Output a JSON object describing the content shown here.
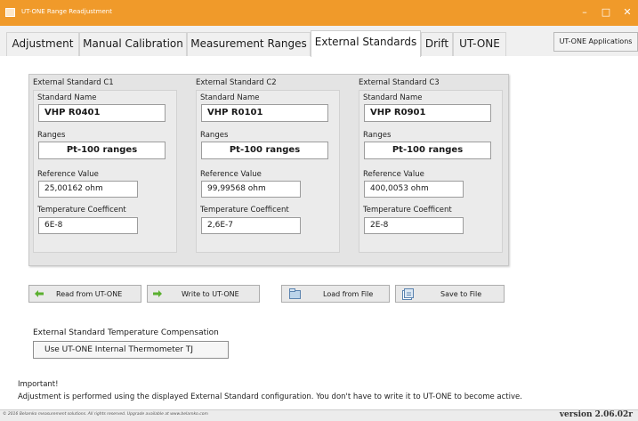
{
  "window": {
    "title": "UT-ONE Range Readjustment",
    "controls": {
      "minimize": "–",
      "maximize": "□",
      "close": "✕"
    }
  },
  "tabs": [
    {
      "label": "Adjustment",
      "active": false
    },
    {
      "label": "Manual Calibration",
      "active": false
    },
    {
      "label": "Measurement Ranges",
      "active": false
    },
    {
      "label": "External Standards",
      "active": true
    },
    {
      "label": "Drift",
      "active": false
    },
    {
      "label": "UT-ONE",
      "active": false
    }
  ],
  "apps_button": "UT-ONE Applications",
  "standards": [
    {
      "title": "External Standard C1",
      "name_label": "Standard Name",
      "name": "VHP R0401",
      "ranges_label": "Ranges",
      "ranges": "Pt-100 ranges",
      "ref_label": "Reference Value",
      "ref": "25,00162 ohm",
      "tc_label": "Temperature Coefficent",
      "tc": "6E-8"
    },
    {
      "title": "External Standard C2",
      "name_label": "Standard Name",
      "name": "VHP R0101",
      "ranges_label": "Ranges",
      "ranges": "Pt-100 ranges",
      "ref_label": "Reference Value",
      "ref": "99,99568 ohm",
      "tc_label": "Temperature Coefficent",
      "tc": "2,6E-7"
    },
    {
      "title": "External Standard C3",
      "name_label": "Standard Name",
      "name": "VHP R0901",
      "ranges_label": "Ranges",
      "ranges": "Pt-100 ranges",
      "ref_label": "Reference Value",
      "ref": "400,0053 ohm",
      "tc_label": "Temperature Coefficent",
      "tc": "2E-8"
    }
  ],
  "buttons": {
    "read": "Read from UT-ONE",
    "write": "Write to UT-ONE",
    "load": "Load from File",
    "save": "Save to File"
  },
  "compensation": {
    "label": "External Standard Temperature Compensation",
    "value": "Use UT-ONE Internal Thermometer TJ"
  },
  "notice": {
    "heading": "Important!",
    "message": "Adjustment is performed using the displayed External Standard configuration. You don't have to write it to UT-ONE to become active."
  },
  "status": {
    "copyright": "© 2016 Belamko measurement solutions. All rights reserved. Upgrade available at www.belamko.com",
    "version": "version 2.06.02r"
  },
  "colors": {
    "titlebar": "#f09a2a",
    "arrow_icon": "#5bb030",
    "panel_bg": "#e4e4e4"
  }
}
